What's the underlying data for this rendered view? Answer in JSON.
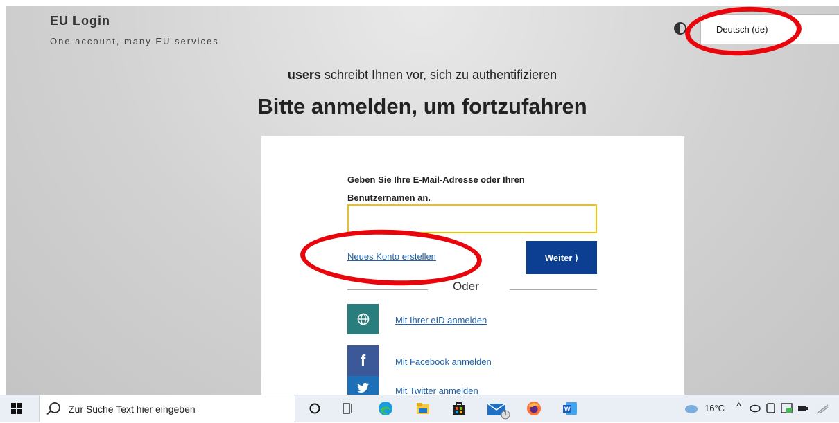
{
  "brand": {
    "title": "EU Login",
    "subtitle": "One account, many EU services"
  },
  "language": {
    "selected": "Deutsch (de)"
  },
  "page": {
    "subtitle_bold": "users",
    "subtitle_rest": " schreibt Ihnen vor, sich zu authentifizieren",
    "heading": "Bitte anmelden, um fortzufahren"
  },
  "form": {
    "email_label": "Geben Sie Ihre E-Mail-Adresse oder Ihren Benutzernamen an.",
    "email_value": "",
    "new_account": "Neues Konto erstellen",
    "next_button": "Weiter ⟩",
    "or": "Oder"
  },
  "social": [
    {
      "label": "Mit Ihrer eID anmelden",
      "icon": "globe-icon",
      "color": "#2a7d7d"
    },
    {
      "label": "Mit Facebook anmelden",
      "icon": "facebook-icon",
      "glyph": "f",
      "color": "#3b5998"
    },
    {
      "label": "Mit Twitter anmelden",
      "icon": "twitter-icon",
      "color": "#1d6fb8"
    }
  ],
  "taskbar": {
    "search_placeholder": "Zur Suche Text hier eingeben",
    "temperature": "16°C",
    "mail_badge": "1"
  },
  "colors": {
    "accent": "#0c3f91",
    "annotation": "#e8060c",
    "input_border": "#f2c300",
    "link": "#1d5fa8"
  }
}
